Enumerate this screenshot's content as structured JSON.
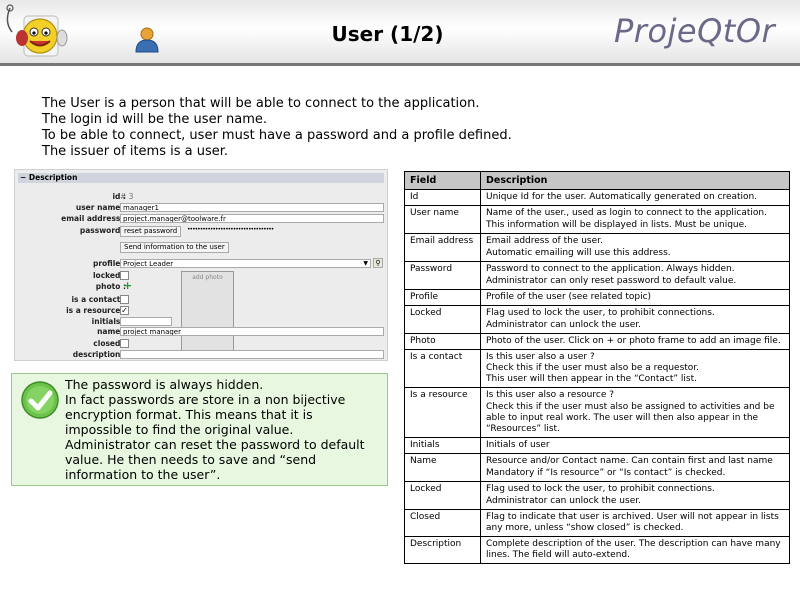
{
  "header": {
    "title": "User (1/2)",
    "brand": "ProjeQtOr"
  },
  "intro": [
    "The User is a person that will be able to connect to the application.",
    "The login id will be the user name.",
    "To be able to connect, user must have a password and a profile defined.",
    "The issuer of items is a user."
  ],
  "form": {
    "section_title": "Description",
    "labels": {
      "id": "id :",
      "user_name": "user name :",
      "email": "email address :",
      "password": "password :",
      "profile": "profile :",
      "locked": "locked :",
      "photo": "photo :",
      "is_contact": "is a contact :",
      "is_resource": "is a resource :",
      "initials": "initials :",
      "name": "name :",
      "closed": "closed :",
      "description": "description :"
    },
    "values": {
      "id": "# 3",
      "user_name": "manager1",
      "email": "project.manager@toolware.fr",
      "password_mask": "••••••••••••••••••••••••••••••••••",
      "profile": "Project Leader",
      "name": "project manager",
      "initials": "",
      "description": ""
    },
    "reset_password_label": "reset password",
    "send_info_label": "Send information to the user",
    "add_photo_label": "add photo",
    "is_resource_checked": true
  },
  "note": {
    "lines": [
      "The password is always hidden.",
      "In fact passwords are store in a non bijective encryption format. This means that it is impossible to find the original value.",
      "Administrator can reset the password to default value. He then needs to save and “send information to the user”."
    ]
  },
  "table": {
    "headers": [
      "Field",
      "Description"
    ],
    "rows": [
      {
        "field": "Id",
        "desc": [
          "Unique Id for the user. Automatically generated on creation."
        ]
      },
      {
        "field": "User name",
        "desc": [
          "Name of the user., used as login to connect to the application.",
          "This information will be displayed in lists. Must be unique."
        ]
      },
      {
        "field": "Email address",
        "desc": [
          "Email address of the user.",
          "Automatic emailing will use this address."
        ]
      },
      {
        "field": "Password",
        "desc": [
          "Password to connect to the application. Always hidden.",
          "Administrator can only reset password to default value."
        ]
      },
      {
        "field": "Profile",
        "desc": [
          "Profile of the user (see related topic)"
        ]
      },
      {
        "field": "Locked",
        "desc": [
          "Flag used to lock the user, to prohibit connections.",
          "Administrator can unlock the user."
        ]
      },
      {
        "field": "Photo",
        "desc": [
          "Photo of the user. Click on + or photo frame to add an image file."
        ]
      },
      {
        "field": "Is a contact",
        "desc": [
          "Is this user also a user ?",
          "Check this if the user must also be a requestor.",
          "This user will then appear in the “Contact” list."
        ]
      },
      {
        "field": "Is a resource",
        "desc": [
          "Is this user also a resource ?",
          "Check this if the user must also be assigned to activities and be able to input real work. The user will then also appear in the “Resources” list."
        ]
      },
      {
        "field": "Initials",
        "desc": [
          "Initials of user"
        ]
      },
      {
        "field": "Name",
        "desc": [
          "Resource and/or  Contact name. Can contain first and last name",
          "Mandatory if “Is resource” or “Is contact”  is checked."
        ]
      },
      {
        "field": "Locked",
        "desc": [
          "Flag used to lock the user, to prohibit connections.",
          "Administrator can unlock the user."
        ]
      },
      {
        "field": "Closed",
        "desc": [
          "Flag to indicate that user is archived. User will not appear in lists any more, unless “show closed” is checked."
        ]
      },
      {
        "field": "Description",
        "desc": [
          "Complete description of the user. The description can have many lines. The field will auto-extend."
        ]
      }
    ]
  },
  "colors": {
    "note_bg": "#e8f8e0",
    "table_header_bg": "#c6c6c6",
    "brand": "#6a6a88"
  },
  "icons": {
    "logo": "mascot-logo-icon",
    "user": "user-icon",
    "note": "check-icon",
    "photo_add": "plus-icon"
  }
}
